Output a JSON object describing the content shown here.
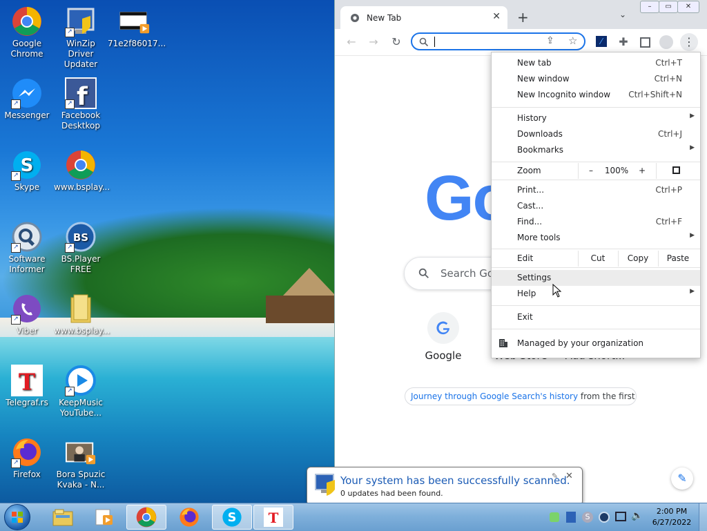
{
  "desktop": {
    "icons": [
      {
        "label": "Google Chrome"
      },
      {
        "label": "WinZip Driver Updater"
      },
      {
        "label": "71e2f86017..."
      },
      {
        "label": "Messenger"
      },
      {
        "label": "Facebook Desktkop"
      },
      {
        "label": "Skype"
      },
      {
        "label": "www.bsplay..."
      },
      {
        "label": "Software Informer"
      },
      {
        "label": "BS.Player FREE"
      },
      {
        "label": "Viber"
      },
      {
        "label": "www.bsplay..."
      },
      {
        "label": "Telegraf.rs"
      },
      {
        "label": "KeepMusic YouTube..."
      },
      {
        "label": "Firefox"
      },
      {
        "label": "Bora Spuzic Kvaka - N..."
      }
    ]
  },
  "browser": {
    "tab_title": "New Tab",
    "new_tab_symbol": "+",
    "google_logo_partial": "Go",
    "search_placeholder": "Search Go",
    "shortcuts": [
      {
        "label": "Google"
      },
      {
        "label": "Web Store"
      },
      {
        "label": "Add short..."
      }
    ],
    "doodle_link": "Journey through Google Search's history",
    "doodle_rest": " from the first Doo..."
  },
  "menu": {
    "new_tab": {
      "label": "New tab",
      "shortcut": "Ctrl+T"
    },
    "new_window": {
      "label": "New window",
      "shortcut": "Ctrl+N"
    },
    "incognito": {
      "label": "New Incognito window",
      "shortcut": "Ctrl+Shift+N"
    },
    "history": {
      "label": "History"
    },
    "downloads": {
      "label": "Downloads",
      "shortcut": "Ctrl+J"
    },
    "bookmarks": {
      "label": "Bookmarks"
    },
    "zoom": {
      "label": "Zoom",
      "minus": "–",
      "value": "100%",
      "plus": "+"
    },
    "print": {
      "label": "Print...",
      "shortcut": "Ctrl+P"
    },
    "cast": {
      "label": "Cast..."
    },
    "find": {
      "label": "Find...",
      "shortcut": "Ctrl+F"
    },
    "more_tools": {
      "label": "More tools"
    },
    "edit": {
      "label": "Edit",
      "cut": "Cut",
      "copy": "Copy",
      "paste": "Paste"
    },
    "settings": {
      "label": "Settings"
    },
    "help": {
      "label": "Help"
    },
    "exit": {
      "label": "Exit"
    },
    "managed": {
      "label": "Managed by your organization"
    }
  },
  "notification": {
    "title": "Your system has been successfully scanned.",
    "subtitle": "0 updates had been found."
  },
  "taskbar": {
    "time": "2:00 PM",
    "date": "6/27/2022"
  }
}
